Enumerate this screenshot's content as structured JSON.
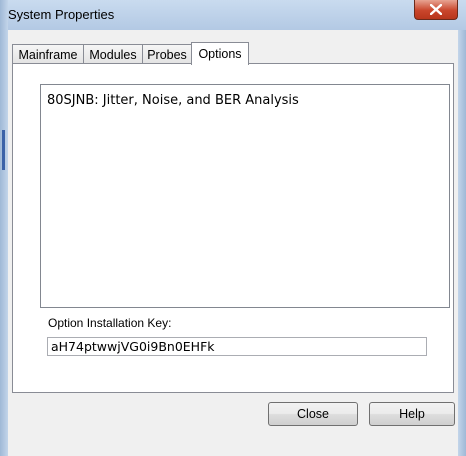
{
  "window": {
    "title": "System Properties",
    "close_icon": "close-x-icon"
  },
  "tabs": [
    {
      "label": "Mainframe",
      "active": false
    },
    {
      "label": "Modules",
      "active": false
    },
    {
      "label": "Probes",
      "active": false
    },
    {
      "label": "Options",
      "active": true
    }
  ],
  "options": {
    "installed": [
      "80SJNB: Jitter, Noise, and BER Analysis"
    ],
    "key_label": "Option Installation Key:",
    "key_value": "aH74ptwwjVG0i9Bn0EHFk"
  },
  "buttons": {
    "close": "Close",
    "help": "Help"
  },
  "colors": {
    "close_button": "#c9462c",
    "frame": "#b9cde5"
  }
}
